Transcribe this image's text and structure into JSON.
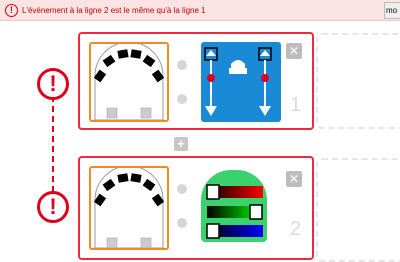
{
  "banner": {
    "message": "L'événement à la ligne 2 est le même qu'à la ligne 1",
    "more_label": "mo",
    "warning_icon": "exclamation-circle-icon"
  },
  "rows": [
    {
      "number": "1",
      "close_label": "✕"
    },
    {
      "number": "2",
      "close_label": "✕"
    }
  ],
  "add_button_label": "+",
  "side_warning_glyph": "!",
  "colors": {
    "error_red": "#ee2b3c",
    "event_orange": "#f08a24",
    "action_blue": "#1a8ad6",
    "led_green": "#3bd16f"
  }
}
